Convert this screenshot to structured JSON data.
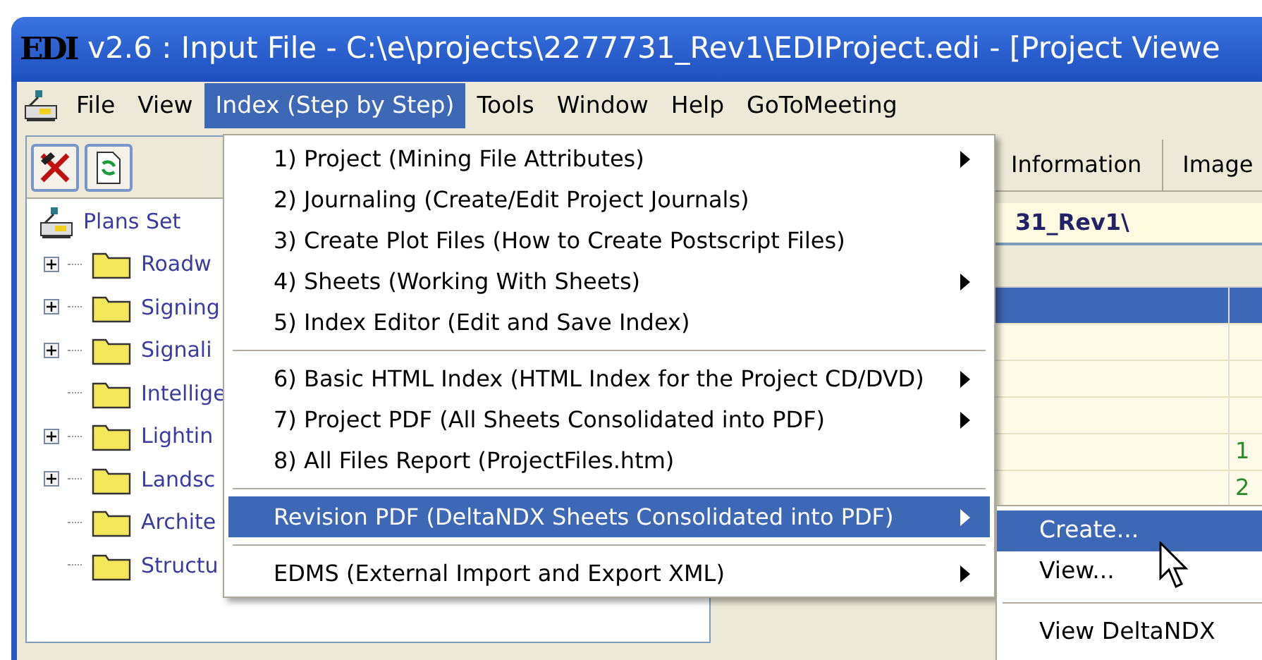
{
  "window": {
    "title": "v2.6 : Input File - C:\\e\\projects\\2277731_Rev1\\EDIProject.edi - [Project Viewe",
    "logo": "EDI"
  },
  "menu_bar": [
    {
      "label": "File",
      "selected": false
    },
    {
      "label": "View",
      "selected": false
    },
    {
      "label": "Index (Step by Step)",
      "selected": true
    },
    {
      "label": "Tools",
      "selected": false
    },
    {
      "label": "Window",
      "selected": false
    },
    {
      "label": "Help",
      "selected": false
    },
    {
      "label": "GoToMeeting",
      "selected": false
    }
  ],
  "tree": {
    "label": "Plans Set",
    "children": [
      {
        "label": "Roadw",
        "has_children": true
      },
      {
        "label": "Signing",
        "has_children": true
      },
      {
        "label": "Signali",
        "has_children": true
      },
      {
        "label": "Intellige",
        "has_children": false
      },
      {
        "label": "Lightin",
        "has_children": true
      },
      {
        "label": "Landsc",
        "has_children": true
      },
      {
        "label": "Archite",
        "has_children": false
      },
      {
        "label": "Structu",
        "has_children": false
      }
    ]
  },
  "right_panel": {
    "tabs": [
      "Information",
      "Image"
    ],
    "path": "31_Rev1\\",
    "rows": [
      {
        "selected": true,
        "column_2": ""
      },
      {
        "selected": false,
        "column_2": ""
      },
      {
        "selected": false,
        "column_2": ""
      },
      {
        "selected": false,
        "column_2": ""
      },
      {
        "selected": false,
        "column_2": "1"
      },
      {
        "selected": false,
        "column_2": "2"
      }
    ]
  },
  "index_menu": [
    {
      "kind": "item",
      "label": "1) Project (Mining File Attributes)",
      "submenu": true,
      "selected": false
    },
    {
      "kind": "item",
      "label": "2) Journaling (Create/Edit Project Journals)",
      "submenu": false,
      "selected": false
    },
    {
      "kind": "item",
      "label": "3) Create Plot Files (How to Create Postscript Files)",
      "submenu": false,
      "selected": false
    },
    {
      "kind": "item",
      "label": "4) Sheets (Working With Sheets)",
      "submenu": true,
      "selected": false
    },
    {
      "kind": "item",
      "label": "5) Index Editor (Edit and Save Index)",
      "submenu": false,
      "selected": false
    },
    {
      "kind": "separator"
    },
    {
      "kind": "item",
      "label": "6) Basic HTML Index (HTML Index for the Project CD/DVD)",
      "submenu": true,
      "selected": false
    },
    {
      "kind": "item",
      "label": "7) Project PDF (All Sheets Consolidated into PDF)",
      "submenu": true,
      "selected": false
    },
    {
      "kind": "item",
      "label": "8) All Files Report (ProjectFiles.htm)",
      "submenu": false,
      "selected": false
    },
    {
      "kind": "separator"
    },
    {
      "kind": "item",
      "label": "Revision PDF (DeltaNDX Sheets Consolidated into PDF)",
      "submenu": true,
      "selected": true
    },
    {
      "kind": "separator"
    },
    {
      "kind": "item",
      "label": "EDMS (External Import and Export XML)",
      "submenu": true,
      "selected": false
    }
  ],
  "submenu": [
    {
      "kind": "item",
      "label": "Create...",
      "selected": true
    },
    {
      "kind": "item",
      "label": "View...",
      "selected": false
    },
    {
      "kind": "separator"
    },
    {
      "kind": "item",
      "label": "View DeltaNDX",
      "selected": false
    }
  ]
}
